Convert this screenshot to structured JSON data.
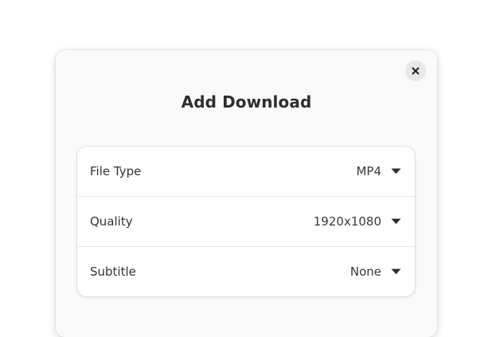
{
  "dialog": {
    "title": "Add Download",
    "rows": [
      {
        "label": "File Type",
        "value": "MP4"
      },
      {
        "label": "Quality",
        "value": "1920x1080"
      },
      {
        "label": "Subtitle",
        "value": "None"
      }
    ]
  },
  "icons": {
    "close": "close-icon",
    "dropdown": "pan-down-icon"
  },
  "colors": {
    "dialog_bg": "#fafafa",
    "card_bg": "#ffffff",
    "text": "#2e2e2e",
    "close_bg": "#e8e8e8"
  }
}
